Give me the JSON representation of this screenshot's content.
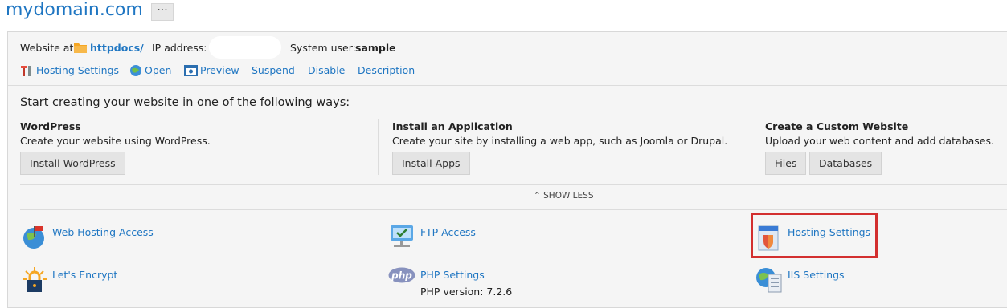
{
  "header": {
    "domain": "mydomain.com",
    "more_label": "···"
  },
  "info": {
    "website_at_label": "Website at",
    "docroot": "httpdocs/",
    "ip_label": "IP address:",
    "system_user_label": "System user:",
    "system_user": "sample"
  },
  "actions": {
    "hosting_settings": "Hosting Settings",
    "open": "Open",
    "preview": "Preview",
    "suspend": "Suspend",
    "disable": "Disable",
    "description": "Description"
  },
  "start": {
    "heading": "Start creating your website in one of the following ways:",
    "wordpress": {
      "title": "WordPress",
      "desc": "Create your website using WordPress.",
      "button": "Install WordPress"
    },
    "app": {
      "title": "Install an Application",
      "desc": "Create your site by installing a web app, such as Joomla or Drupal.",
      "button": "Install Apps"
    },
    "custom": {
      "title": "Create a Custom Website",
      "desc": "Upload your web content and add databases.",
      "files_button": "Files",
      "databases_button": "Databases"
    },
    "show_less": "SHOW LESS"
  },
  "tools": {
    "web_hosting_access": "Web Hosting Access",
    "ftp_access": "FTP Access",
    "hosting_settings": "Hosting Settings",
    "lets_encrypt": "Let's Encrypt",
    "php_settings": "PHP Settings",
    "php_version": "PHP version: 7.2.6",
    "iis_settings": "IIS Settings"
  },
  "colors": {
    "link": "#1f76c2",
    "highlight": "#d32f2f"
  }
}
